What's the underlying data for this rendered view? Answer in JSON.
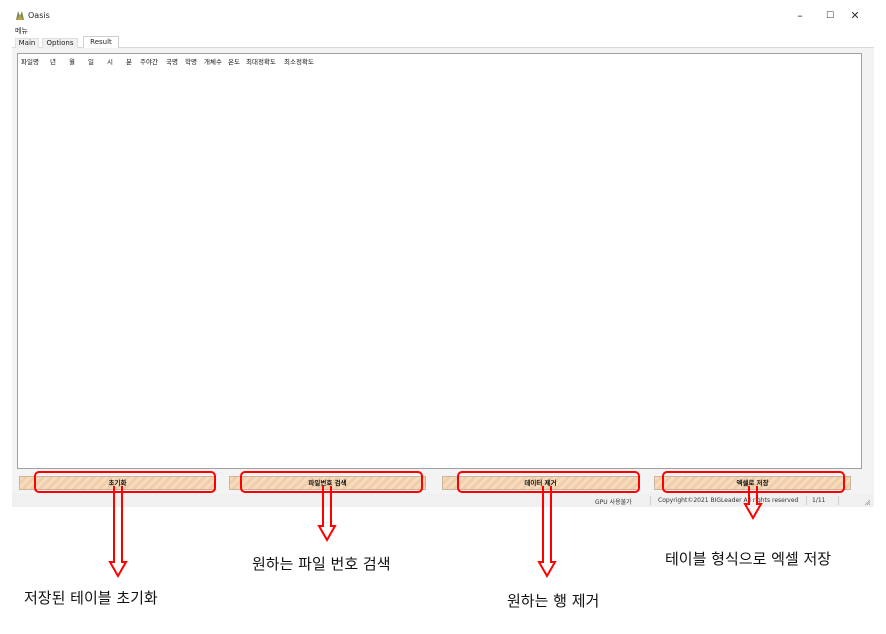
{
  "window": {
    "title": "Oasis",
    "minimize": "–",
    "maximize": "☐",
    "close": "✕"
  },
  "menu": {
    "label": "메뉴"
  },
  "tabs": [
    {
      "label": "Main"
    },
    {
      "label": "Options"
    },
    {
      "label": "Result"
    }
  ],
  "table": {
    "columns": [
      "파일명",
      "년",
      "월",
      "일",
      "시",
      "분",
      "주야간",
      "국명",
      "학명",
      "개체수",
      "온도",
      "최대정확도",
      "최소정확도"
    ],
    "rows": []
  },
  "buttons": {
    "reset": "초기화",
    "search": "파일번호 검색",
    "delete": "데이터 제거",
    "excel": "엑셀로 저장"
  },
  "status": {
    "gpu": "GPU 사용불가",
    "copyright": "Copyright©2021 BIGLeader All rights reserved",
    "page": "1/11"
  },
  "annotations": {
    "reset": "저장된 테이블 초기화",
    "search": "원하는 파일 번호 검색",
    "delete": "원하는 행 제거",
    "excel": "테이블 형식으로 엑셀 저장"
  },
  "colors": {
    "callout": "#ff0000",
    "button_fill": "#f7dbbe"
  }
}
